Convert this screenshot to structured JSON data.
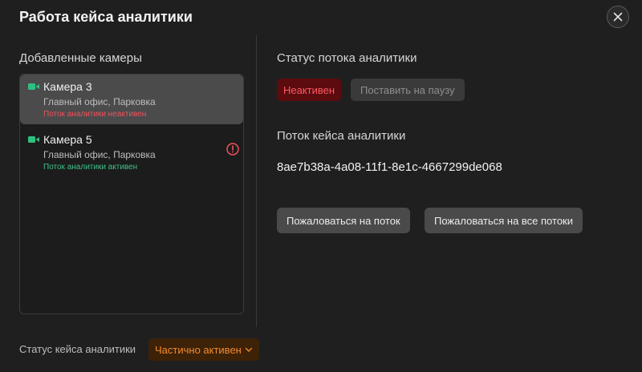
{
  "dialog": {
    "title": "Работа кейса аналитики"
  },
  "left": {
    "section_title": "Добавленные камеры",
    "cameras": [
      {
        "name": "Камера 3",
        "location": "Главный офис, Парковка",
        "status": "Поток аналитики неактивен"
      },
      {
        "name": "Камера 5",
        "location": "Главный офис, Парковка",
        "status": "Поток аналитики активен"
      }
    ]
  },
  "right": {
    "stream_status_title": "Статус потока аналитики",
    "status_badge": "Неактивен",
    "pause_button": "Поставить на паузу",
    "stream_title": "Поток кейса аналитики",
    "stream_id": "8ae7b38a-4a08-11f1-8e1c-4667299de068",
    "complain_stream_button": "Пожаловаться на поток",
    "complain_all_button": "Пожаловаться на все потоки"
  },
  "footer": {
    "case_status_label": "Статус кейса аналитики",
    "case_status_value": "Частично активен"
  },
  "colors": {
    "background": "#1f1f20",
    "camera_icon": "#2fbf7f",
    "inactive": "#ff5a62",
    "active": "#3fc285",
    "partial": "#f28a2e"
  },
  "icons": {
    "close": "close-icon",
    "camera": "video-camera-icon",
    "alert": "alert-circle-icon",
    "dropdown": "chevron-down-icon"
  }
}
